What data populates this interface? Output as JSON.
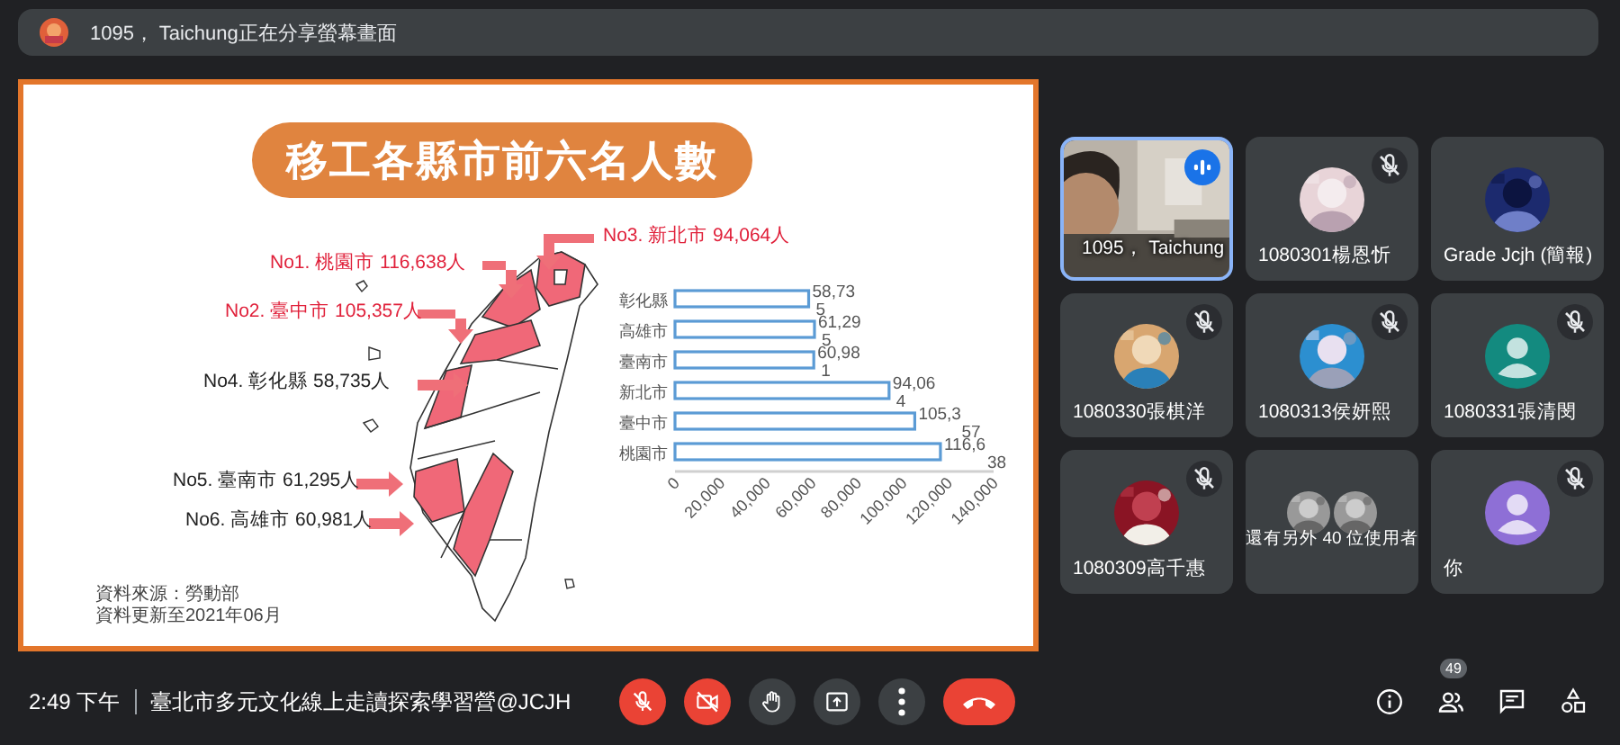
{
  "banner": {
    "text": "1095， Taichung正在分享螢幕畫面"
  },
  "slide": {
    "title": "移工各縣市前六名人數",
    "callouts": [
      {
        "text": "No1. 桃園市 116,638人",
        "highlight": true
      },
      {
        "text": "No2. 臺中市 105,357人",
        "highlight": true
      },
      {
        "text": "No3. 新北市 94,064人",
        "highlight": true
      },
      {
        "text": "No4. 彰化縣 58,735人",
        "highlight": false
      },
      {
        "text": "No5. 臺南市 61,295人",
        "highlight": false
      },
      {
        "text": "No6. 高雄市 60,981人",
        "highlight": false
      }
    ],
    "sources": [
      "資料來源：勞動部",
      "資料更新至2021年06月"
    ],
    "chart_data": {
      "type": "bar",
      "orientation": "horizontal",
      "categories": [
        "彰化縣",
        "高雄市",
        "臺南市",
        "新北市",
        "臺中市",
        "桃園市"
      ],
      "values": [
        58735,
        61295,
        60981,
        94064,
        105357,
        116638
      ],
      "value_labels": [
        "58,735",
        "61,295",
        "60,981",
        "94,064",
        "105,357",
        "116,638"
      ],
      "xlim": [
        0,
        140000
      ],
      "xticks": [
        {
          "value": 0,
          "label": "0"
        },
        {
          "value": 20000,
          "label": "20,000"
        },
        {
          "value": 40000,
          "label": "40,000"
        },
        {
          "value": 60000,
          "label": "60,000"
        },
        {
          "value": 80000,
          "label": "80,000"
        },
        {
          "value": 100000,
          "label": "100,000"
        },
        {
          "value": 120000,
          "label": "120,000"
        },
        {
          "value": 140000,
          "label": "140,000"
        }
      ]
    }
  },
  "participants": [
    {
      "name": "1095， Taichung",
      "kind": "video",
      "muted": false,
      "speaking": true
    },
    {
      "name": "1080301楊恩忻",
      "muted": true,
      "speaking": false
    },
    {
      "name": "Grade Jcjh (簡報)",
      "muted": false,
      "speaking": false
    },
    {
      "name": "1080330張棋洋",
      "muted": true,
      "speaking": false
    },
    {
      "name": "1080313侯妍熙",
      "muted": true,
      "speaking": false
    },
    {
      "name": "1080331張清閔",
      "kind": "default",
      "color": "#138a7f",
      "muted": true,
      "speaking": false
    },
    {
      "name": "1080309高千惠",
      "muted": true,
      "speaking": false
    },
    {
      "name": "還有另外 40 位使用者",
      "kind": "others",
      "muted": false,
      "speaking": false
    },
    {
      "name": "你",
      "kind": "default",
      "color": "#8e6fd6",
      "muted": true,
      "speaking": false
    }
  ],
  "bottom_bar": {
    "time": "2:49 下午",
    "meeting": "臺北市多元文化線上走讀探索學習營@JCJH",
    "mic_on": false,
    "camera_on": false,
    "people_count": "49"
  }
}
